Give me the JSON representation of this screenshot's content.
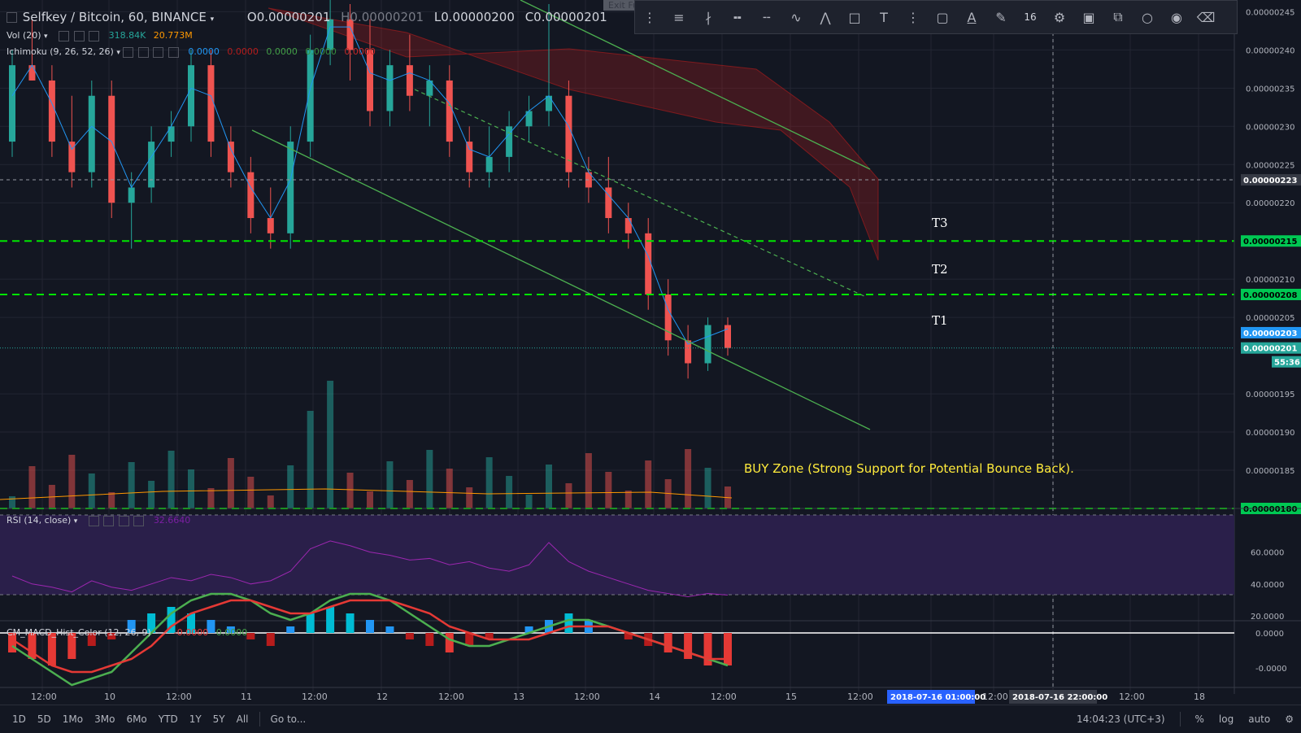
{
  "header": {
    "symbol": "Selfkey / Bitcoin, 60, BINANCE",
    "ohlc": {
      "o": "O0.00000201",
      "h": "H0.00000201",
      "l": "L0.00000200",
      "c": "C0.00000201"
    },
    "vol": {
      "label": "Vol (20)",
      "v1": "318.84K",
      "v2": "20.773M"
    },
    "ichimoku": {
      "label": "Ichimoku (9, 26, 52, 26)",
      "v1": "0.0000",
      "v2": "0.0000",
      "v3": "0.0000",
      "v4": "0.0000",
      "v5": "0.0000"
    },
    "rsi": {
      "label": "RSI (14, close)",
      "value": "32.6640"
    },
    "macd": {
      "label": "CM_MACD_Hist_Color (12, 26, 9)",
      "v1": "-0.0000",
      "v2": "0.0000"
    }
  },
  "toolbar": {
    "exit_label": "Exit Fu",
    "font_size": "16"
  },
  "annotations": {
    "t1": "T1",
    "t2": "T2",
    "t3": "T3",
    "buy_zone": "BUY Zone (Strong Support for Potential Bounce Back)."
  },
  "bottom_bar": {
    "timeframes": [
      "1D",
      "5D",
      "1Mo",
      "3Mo",
      "6Mo",
      "YTD",
      "1Y",
      "5Y",
      "All"
    ],
    "goto": "Go to...",
    "clock": "14:04:23 (UTC+3)",
    "percent": "%",
    "log": "log",
    "auto": "auto"
  },
  "colors": {
    "background": "#131722",
    "up": "#26a69a",
    "down": "#ef5350",
    "level_line": "#00e600",
    "trend_line": "#4caf50",
    "rsi_band": "#2a1f4a",
    "rsi_line": "#9c27b0",
    "macd_fast": "#4caf50",
    "macd_slow": "#e53935",
    "buy_text": "#ffeb3b"
  },
  "chart_data": {
    "type": "candlestick",
    "price_axis": {
      "ticks": [
        "0.00000245",
        "0.00000240",
        "0.00000235",
        "0.00000230",
        "0.00000225",
        "0.00000220",
        "0.00000210",
        "0.00000205",
        "0.00000195",
        "0.00000190",
        "0.00000185"
      ],
      "ylim": [
        1.8e-06,
        2.46e-06
      ]
    },
    "time_axis": {
      "labels": [
        "12:00",
        "10",
        "12:00",
        "11",
        "12:00",
        "12",
        "12:00",
        "13",
        "12:00",
        "14",
        "12:00",
        "15",
        "12:00",
        "2018-07-16 01:00:00",
        "12:00",
        "2018-07-16 22:00:00",
        "12:00",
        "18"
      ]
    },
    "price_badges": [
      {
        "value": "0.00000223",
        "kind": "crosshair"
      },
      {
        "value": "0.00000215",
        "kind": "level"
      },
      {
        "value": "0.00000208",
        "kind": "level"
      },
      {
        "value": "0.00000203",
        "kind": "ichimoku"
      },
      {
        "value": "0.00000201",
        "kind": "last"
      },
      {
        "value": "55:36",
        "kind": "countdown"
      },
      {
        "value": "0.00000180",
        "kind": "level"
      }
    ],
    "levels": [
      {
        "name": "T3",
        "price": 2.15e-06
      },
      {
        "name": "T2",
        "price": 2.08e-06
      },
      {
        "name": "T1",
        "price": 2.01e-06
      },
      {
        "name": "BUY",
        "price": 1.8e-06
      }
    ],
    "candles": [
      [
        2.28e-06,
        2.4e-06,
        2.26e-06,
        2.38e-06
      ],
      [
        2.38e-06,
        2.44e-06,
        2.36e-06,
        2.36e-06
      ],
      [
        2.36e-06,
        2.38e-06,
        2.26e-06,
        2.28e-06
      ],
      [
        2.28e-06,
        2.34e-06,
        2.22e-06,
        2.24e-06
      ],
      [
        2.24e-06,
        2.36e-06,
        2.22e-06,
        2.34e-06
      ],
      [
        2.34e-06,
        2.36e-06,
        2.18e-06,
        2.2e-06
      ],
      [
        2.2e-06,
        2.24e-06,
        2.14e-06,
        2.22e-06
      ],
      [
        2.22e-06,
        2.3e-06,
        2.2e-06,
        2.28e-06
      ],
      [
        2.28e-06,
        2.32e-06,
        2.26e-06,
        2.3e-06
      ],
      [
        2.3e-06,
        2.4e-06,
        2.28e-06,
        2.38e-06
      ],
      [
        2.38e-06,
        2.4e-06,
        2.26e-06,
        2.28e-06
      ],
      [
        2.28e-06,
        2.3e-06,
        2.22e-06,
        2.24e-06
      ],
      [
        2.24e-06,
        2.26e-06,
        2.16e-06,
        2.18e-06
      ],
      [
        2.18e-06,
        2.22e-06,
        2.14e-06,
        2.16e-06
      ],
      [
        2.16e-06,
        2.3e-06,
        2.14e-06,
        2.28e-06
      ],
      [
        2.28e-06,
        2.42e-06,
        2.26e-06,
        2.4e-06
      ],
      [
        2.4e-06,
        2.48e-06,
        2.38e-06,
        2.44e-06
      ],
      [
        2.44e-06,
        2.46e-06,
        2.36e-06,
        2.4e-06
      ],
      [
        2.4e-06,
        2.44e-06,
        2.3e-06,
        2.32e-06
      ],
      [
        2.32e-06,
        2.4e-06,
        2.3e-06,
        2.38e-06
      ],
      [
        2.38e-06,
        2.42e-06,
        2.32e-06,
        2.34e-06
      ],
      [
        2.34e-06,
        2.38e-06,
        2.3e-06,
        2.36e-06
      ],
      [
        2.36e-06,
        2.38e-06,
        2.26e-06,
        2.28e-06
      ],
      [
        2.28e-06,
        2.3e-06,
        2.22e-06,
        2.24e-06
      ],
      [
        2.24e-06,
        2.3e-06,
        2.22e-06,
        2.26e-06
      ],
      [
        2.26e-06,
        2.32e-06,
        2.24e-06,
        2.3e-06
      ],
      [
        2.3e-06,
        2.34e-06,
        2.28e-06,
        2.32e-06
      ],
      [
        2.32e-06,
        2.46e-06,
        2.3e-06,
        2.34e-06
      ],
      [
        2.34e-06,
        2.36e-06,
        2.22e-06,
        2.24e-06
      ],
      [
        2.24e-06,
        2.26e-06,
        2.2e-06,
        2.22e-06
      ],
      [
        2.22e-06,
        2.26e-06,
        2.16e-06,
        2.18e-06
      ],
      [
        2.18e-06,
        2.2e-06,
        2.14e-06,
        2.16e-06
      ],
      [
        2.16e-06,
        2.18e-06,
        2.06e-06,
        2.08e-06
      ],
      [
        2.08e-06,
        2.1e-06,
        2e-06,
        2.02e-06
      ],
      [
        2.02e-06,
        2.04e-06,
        1.97e-06,
        1.99e-06
      ],
      [
        1.99e-06,
        2.05e-06,
        1.98e-06,
        2.04e-06
      ],
      [
        2.04e-06,
        2.05e-06,
        2e-06,
        2.01e-06
      ]
    ],
    "rsi": {
      "ticks": [
        "60.0000",
        "40.0000",
        "20.0000"
      ],
      "bands": [
        70,
        30
      ],
      "values": [
        45,
        40,
        38,
        35,
        42,
        38,
        36,
        40,
        44,
        42,
        46,
        44,
        40,
        42,
        48,
        62,
        67,
        64,
        60,
        58,
        55,
        56,
        52,
        54,
        50,
        48,
        52,
        66,
        54,
        48,
        44,
        40,
        36,
        34,
        32,
        34,
        33
      ]
    },
    "macd": {
      "ticks": [
        "0.0000",
        "-0.0000"
      ],
      "histogram": [
        -3,
        -4,
        -5,
        -4,
        -2,
        -1,
        2,
        3,
        4,
        3,
        2,
        1,
        -1,
        -2,
        1,
        3,
        4,
        3,
        2,
        1,
        -1,
        -2,
        -3,
        -2,
        -1,
        0,
        1,
        2,
        3,
        2,
        0,
        -1,
        -2,
        -3,
        -4,
        -5,
        -5
      ],
      "fast": [
        -2,
        -4,
        -6,
        -8,
        -7,
        -6,
        -3,
        0,
        3,
        5,
        6,
        6,
        5,
        3,
        2,
        3,
        5,
        6,
        6,
        5,
        3,
        1,
        -1,
        -2,
        -2,
        -1,
        0,
        1,
        2,
        2,
        1,
        0,
        -1,
        -2,
        -3,
        -4,
        -5
      ],
      "slow": [
        -1,
        -3,
        -5,
        -6,
        -6,
        -5,
        -4,
        -2,
        1,
        3,
        4,
        5,
        5,
        4,
        3,
        3,
        4,
        5,
        5,
        5,
        4,
        3,
        1,
        0,
        -1,
        -1,
        -1,
        0,
        1,
        1,
        1,
        0,
        -1,
        -2,
        -3,
        -4,
        -4
      ]
    }
  }
}
